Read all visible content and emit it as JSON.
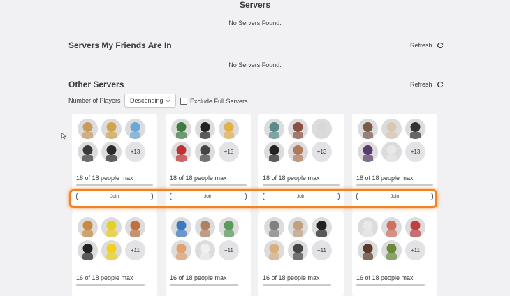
{
  "page": {
    "servers_title": "Servers",
    "servers_empty": "No Servers Found.",
    "friends_title": "Servers My Friends Are In",
    "friends_refresh": "Refresh",
    "friends_empty": "No Servers Found.",
    "other_title": "Other Servers",
    "other_refresh": "Refresh",
    "filter_label": "Number of Players",
    "sort_value": "Descending",
    "exclude_label": "Exclude Full Servers"
  },
  "colors": {
    "highlight": "#f58220",
    "card_bg": "#ffffff",
    "page_bg": "#f1f1f3"
  },
  "server_cards": [
    {
      "people": "18 of 18 people max",
      "more": "+13",
      "join": "Join",
      "fill": 1.0
    },
    {
      "people": "18 of 18 people max",
      "more": "+13",
      "join": "Join",
      "fill": 1.0
    },
    {
      "people": "18 of 18 people max",
      "more": "+13",
      "join": "Join",
      "fill": 1.0
    },
    {
      "people": "18 of 18 people max",
      "more": "+13",
      "join": "Join",
      "fill": 1.0
    },
    {
      "people": "16 of 18 people max",
      "more": "+11",
      "fill": 0.89
    },
    {
      "people": "16 of 18 people max",
      "more": "+11",
      "fill": 0.89
    },
    {
      "people": "16 of 18 people max",
      "more": "+11",
      "fill": 0.89
    },
    {
      "people": "16 of 18 people max",
      "more": "+11",
      "fill": 0.89
    }
  ]
}
